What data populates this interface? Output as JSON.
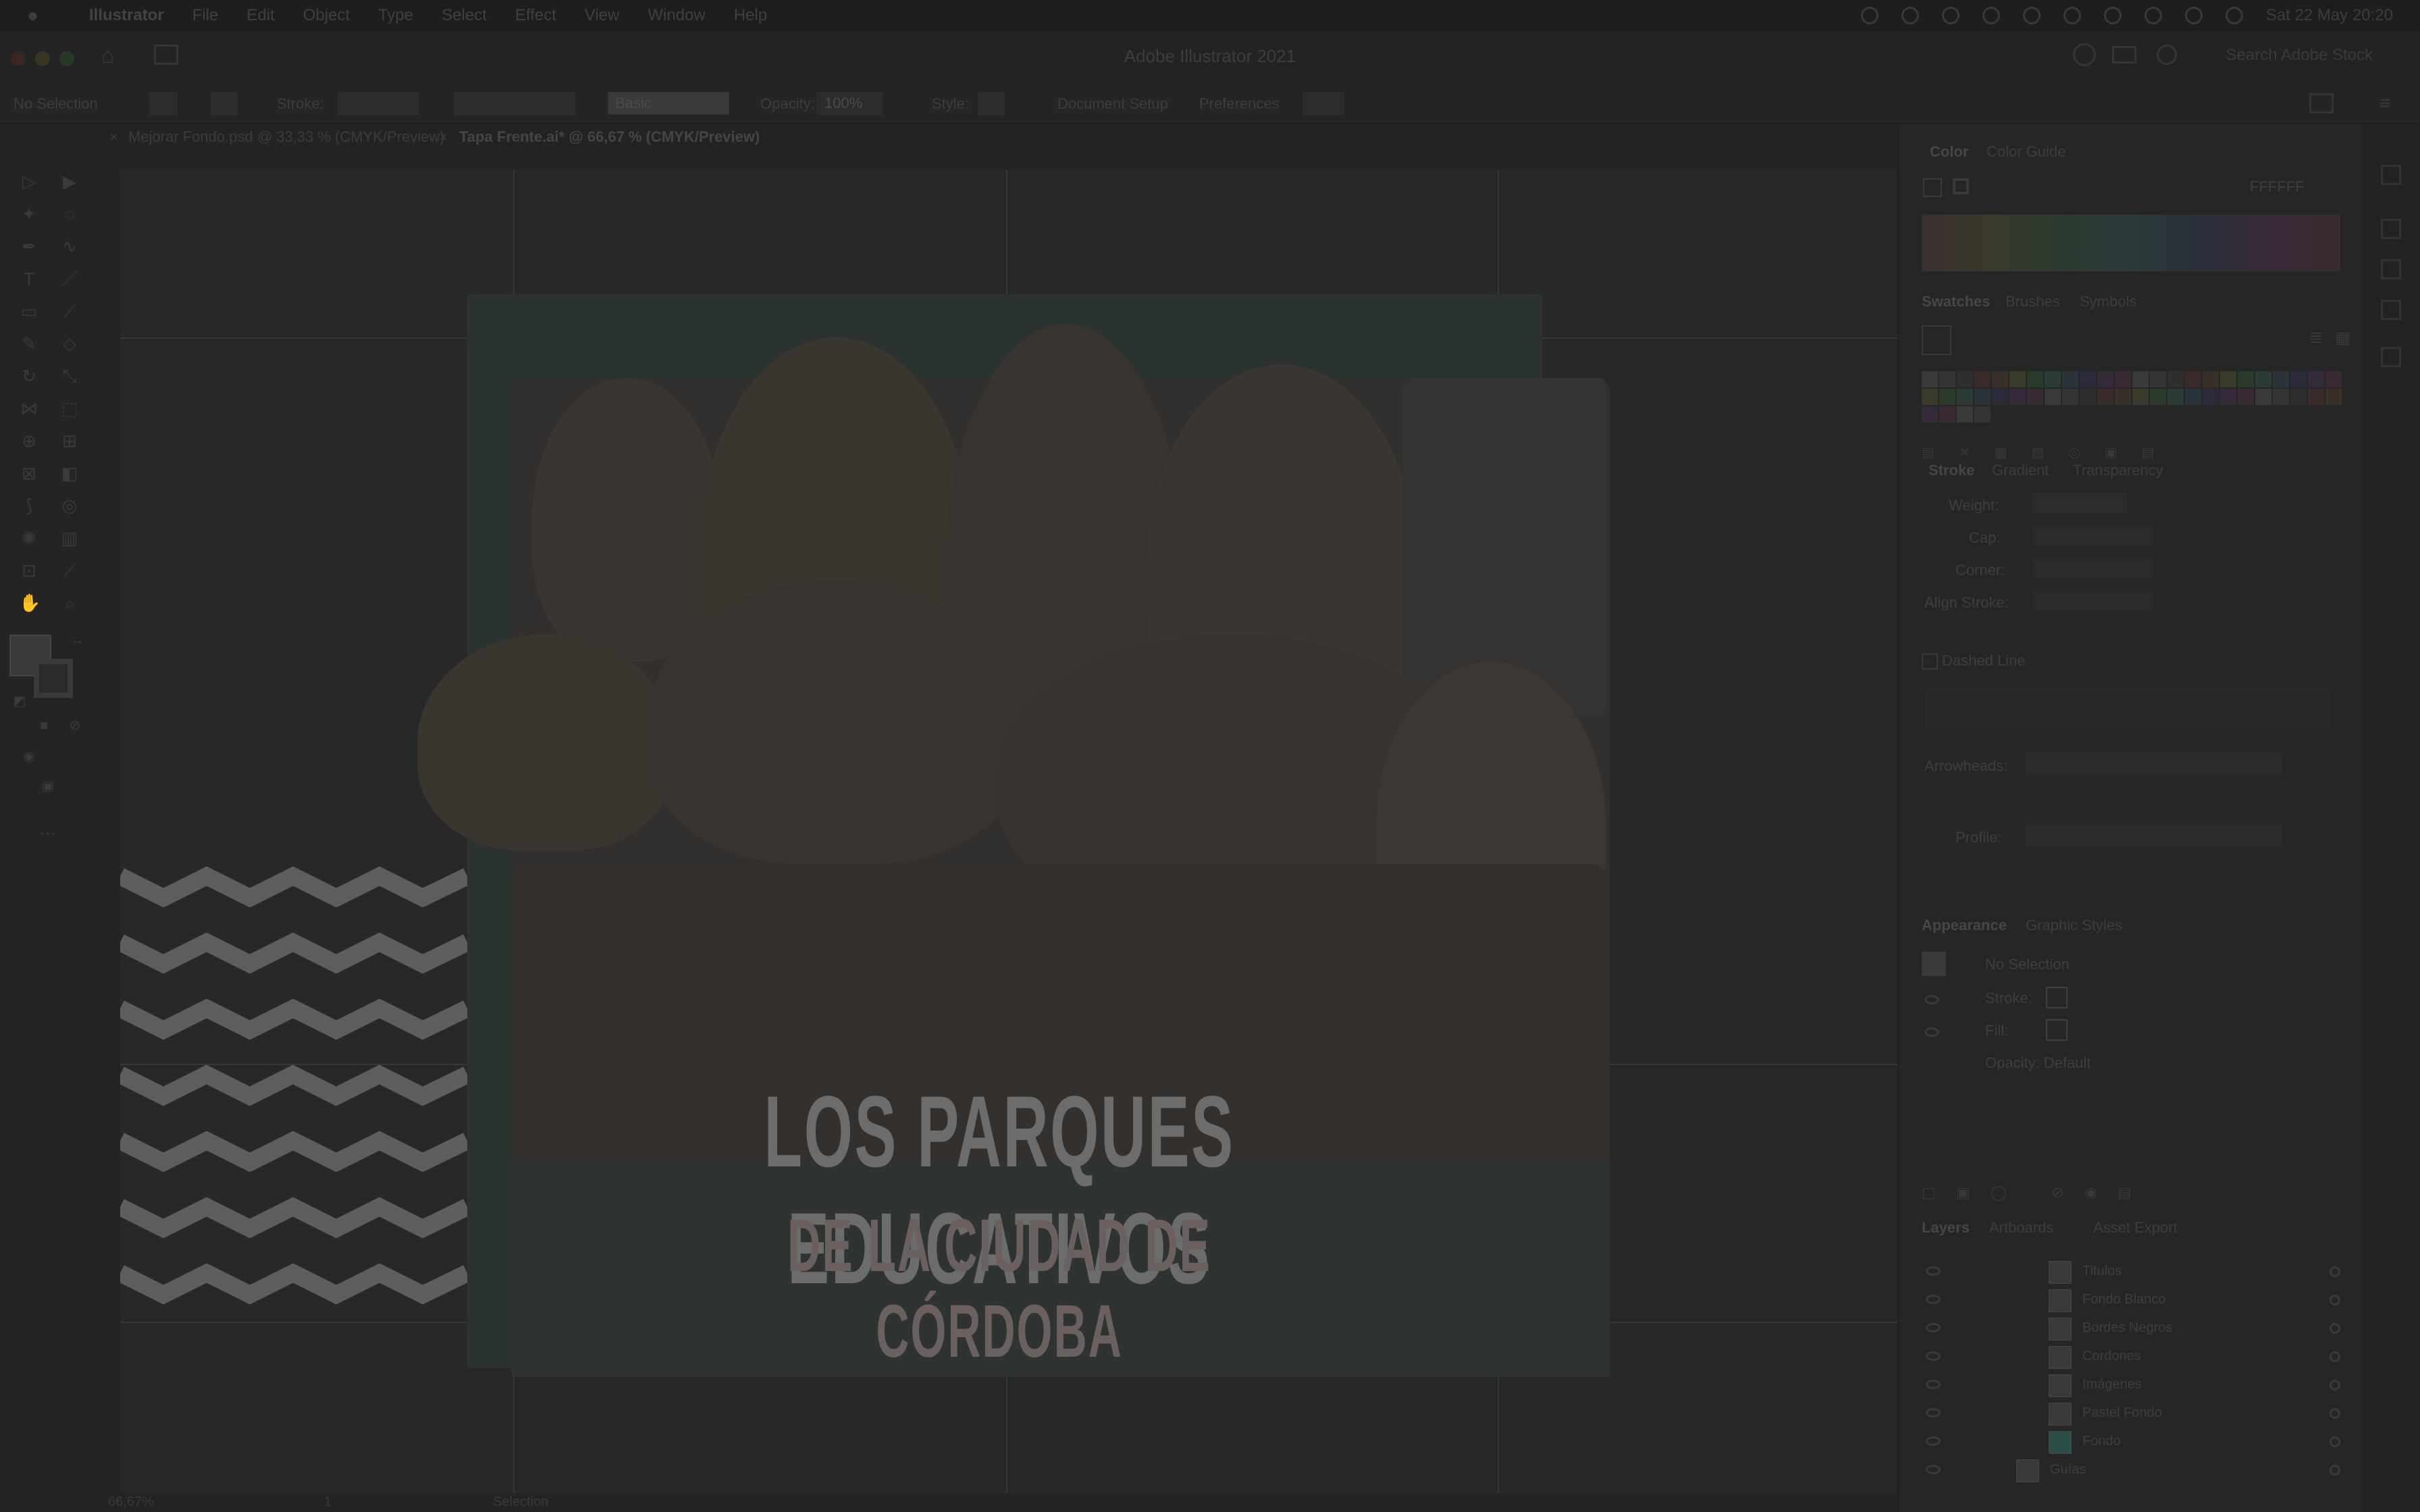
{
  "menubar": {
    "app_name": "Illustrator",
    "items": [
      "File",
      "Edit",
      "Object",
      "Type",
      "Select",
      "Effect",
      "View",
      "Window",
      "Help"
    ],
    "clock": "Sat 22 May  20:20"
  },
  "window": {
    "title": "Adobe Illustrator 2021",
    "search_placeholder": "Search Adobe Stock"
  },
  "controlbar": {
    "no_selection": "No Selection",
    "stroke_label": "Stroke:",
    "brush_label": "Basic",
    "opacity_label": "Opacity:",
    "opacity_value": "100%",
    "style_label": "Style:",
    "document_setup": "Document Setup",
    "preferences": "Preferences"
  },
  "tabs": [
    {
      "label": "Mejorar Fondo.psd @ 33,33 % (CMYK/Preview)",
      "active": false
    },
    {
      "label": "Tapa Frente.ai* @ 66,67 % (CMYK/Preview)",
      "active": true
    }
  ],
  "artwork": {
    "title_line1": "LOS PARQUES EDUCATIVOS",
    "title_line2": "DE LA CIUDAD DE CÓRDOBA"
  },
  "statusbar": {
    "zoom": "66,67%",
    "artboard": "1",
    "tool": "Selection"
  },
  "panels": {
    "color_tabs": [
      "Color",
      "Color Guide"
    ],
    "color_hex": "FFFFFF",
    "swatch_tabs": [
      "Swatches",
      "Brushes",
      "Symbols"
    ],
    "stroke_tabs": [
      "Stroke",
      "Gradient",
      "Transparency"
    ],
    "stroke_rows": [
      "Weight:",
      "Cap:",
      "Corner:",
      "Align Stroke:"
    ],
    "dashed_line": "Dashed Line",
    "arrowheads": "Arrowheads:",
    "profile": "Profile:",
    "appearance_tabs": [
      "Appearance",
      "Graphic Styles"
    ],
    "appearance_title": "No Selection",
    "appearance_rows": [
      "Stroke:",
      "Fill:",
      "Opacity:  Default"
    ],
    "layers_tabs": [
      "Layers",
      "Artboards",
      "Asset Export"
    ],
    "layers": [
      {
        "name": "Titulos",
        "color": "#2d4f6a"
      },
      {
        "name": "Fondo Blanco",
        "color": "#2d4f6a"
      },
      {
        "name": "Bordes Negros",
        "color": "#2d4f6a"
      },
      {
        "name": "Cordones",
        "color": "#2d4f6a"
      },
      {
        "name": "Imágenes",
        "color": "#2d4f6a"
      },
      {
        "name": "Pastel Fondo",
        "color": "#2d4f6a"
      },
      {
        "name": "Fondo",
        "color": "#2d4f6a"
      },
      {
        "name": "Guías",
        "color": "#2d4f6a"
      }
    ]
  },
  "colors": {
    "menubar_bg": "#1e1e1e",
    "panel_bg": "#262626",
    "canvas_bg": "#282828",
    "artboard_accent": "#2a3330",
    "title_red": "#6b5f60"
  }
}
